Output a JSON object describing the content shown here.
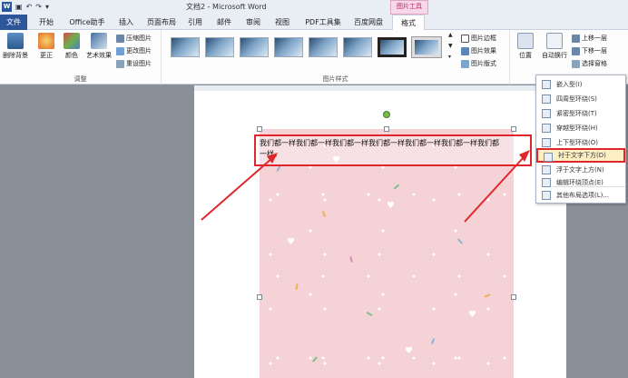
{
  "window": {
    "title": "文档2 - Microsoft Word",
    "context_tab": "图片工具",
    "app_icon": "W"
  },
  "qat": {
    "undo": "↶",
    "redo": "↷"
  },
  "tabs": [
    {
      "label": "文件"
    },
    {
      "label": "开始"
    },
    {
      "label": "Office助手"
    },
    {
      "label": "插入"
    },
    {
      "label": "页面布局"
    },
    {
      "label": "引用"
    },
    {
      "label": "邮件"
    },
    {
      "label": "审阅"
    },
    {
      "label": "视图"
    },
    {
      "label": "PDF工具集"
    },
    {
      "label": "百度网盘"
    },
    {
      "label": "格式"
    }
  ],
  "ribbon": {
    "adjust": {
      "group_name": "调整",
      "remove_bg": "删除背景",
      "corrections": "更正",
      "color": "颜色",
      "artistic": "艺术效果",
      "compress": "压缩图片",
      "change": "更改图片",
      "reset": "重设图片"
    },
    "styles": {
      "group_name": "图片样式",
      "border": "图片边框",
      "effects": "图片效果",
      "layout": "图片版式"
    },
    "arrange": {
      "position": "位置",
      "wrap": "自动换行",
      "bring_forward": "上移一层",
      "send_backward": "下移一层",
      "selection_pane": "选择窗格"
    }
  },
  "document": {
    "text": "我们都一样我们都一样我们都一样我们都一样我们都一样我们都一样我们都一样。"
  },
  "wrap_menu": {
    "items": [
      {
        "label": "嵌入型(I)"
      },
      {
        "label": "四周型环绕(S)"
      },
      {
        "label": "紧密型环绕(T)"
      },
      {
        "label": "穿越型环绕(H)"
      },
      {
        "label": "上下型环绕(O)"
      },
      {
        "label": "衬于文字下方(D)",
        "highlighted": true
      },
      {
        "label": "浮于文字上方(N)"
      },
      {
        "label": "编辑环绕顶点(E)"
      },
      {
        "label": "其他布局选项(L)..."
      }
    ]
  },
  "colors": {
    "accent": "#2b579a",
    "highlight": "#e0262b",
    "context": "#c01a6a"
  }
}
